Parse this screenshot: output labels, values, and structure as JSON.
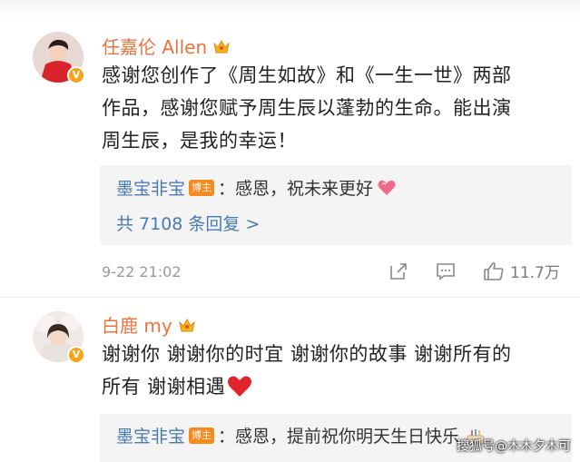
{
  "header": {
    "top_text": "···"
  },
  "comments": [
    {
      "username": "任嘉伦 Allen",
      "text_lines": [
        "感谢您创作了《周生如故》和《一生一世》两部",
        "作品，感谢您赋予周生辰以蓬勃的生命。能出演",
        "周生辰，是我的幸运！"
      ],
      "reply": {
        "user": "墨宝非宝",
        "tag": "博主",
        "text": "：感恩，祝未来更好"
      },
      "reply_count": "共 7108 条回复 >",
      "timestamp": "9-22 21:02",
      "likes": "11.7万"
    },
    {
      "username": "白鹿 my",
      "text_lines": [
        "谢谢你 谢谢你的时宜 谢谢你的故事 谢谢所有的",
        "所有 谢谢相遇"
      ],
      "reply": {
        "user": "墨宝非宝",
        "tag": "博主",
        "text": "：感恩，提前祝你明天生日快乐"
      }
    }
  ],
  "watermark": "搜狐号@木木夕木可",
  "colors": {
    "username": "#eb7340",
    "reply_user": "#4a7ab4",
    "tag": "#f78a1c",
    "badge": "#f7a21b"
  }
}
